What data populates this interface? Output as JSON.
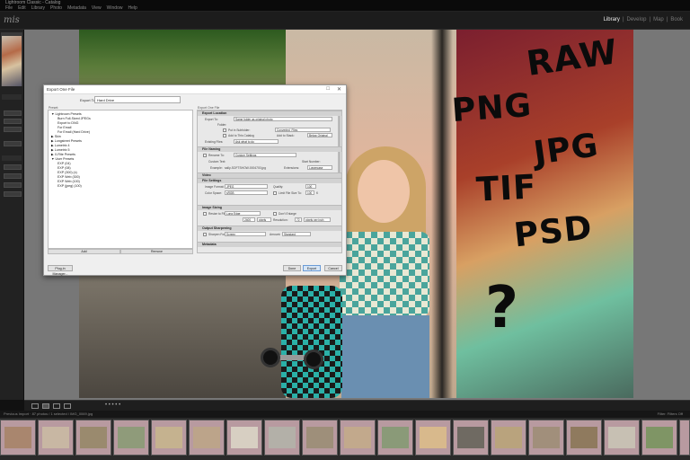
{
  "window": {
    "title": "Lightroom Classic - Catalog",
    "menu": [
      "File",
      "Edit",
      "Library",
      "Photo",
      "Metadata",
      "View",
      "Window",
      "Help"
    ]
  },
  "header": {
    "identity": "mis",
    "modules": [
      "Library",
      "Develop",
      "Map",
      "Book"
    ],
    "active_module": "Library"
  },
  "overlay_text": {
    "raw": "RAW",
    "png": "PNG",
    "jpg": "JPG",
    "tif": "TIF",
    "psd": "PSD",
    "question": "?"
  },
  "dialog": {
    "title": "Export One File",
    "export_to_label": "Export To:",
    "export_to_value": "Hard Drive",
    "preset_label": "Preset:",
    "settings_label": "Export One File",
    "presets": [
      "▼ Lightroom Presets",
      "Burn Full-Sized JPEGs",
      "Export to DNG",
      "For Email",
      "For Email (Hard Drive)",
      "▶ Skin",
      "▶ Longstreet Presets",
      "▶ Lumetrix 4",
      "▶ Lumetrix 5",
      "▶ X-Rite Presets",
      "▼ User Presets",
      "EXP (04)",
      "EXP (08)",
      "EXP (300) (x)",
      "EXP Web (300)",
      "EXP Web (100)",
      "EXP (jpeg) (100)"
    ],
    "preset_buttons": [
      "Add",
      "Remove"
    ],
    "sections": {
      "export_location": "Export Location",
      "file_naming": "File Naming",
      "video": "Video",
      "file_settings": "File Settings",
      "image_sizing": "Image Sizing",
      "output_sharpening": "Output Sharpening",
      "metadata": "Metadata"
    },
    "fields": {
      "export_to": "Export To:",
      "export_to_value": "Same folder as original photo",
      "folder": "Folder:",
      "put_in_subfolder": "Put in Subfolder:",
      "subfolder_value": "Converted_Files",
      "add_to_catalog": "Add to This Catalog",
      "add_to_stack": "Add to Stack:",
      "add_to_stack_value": "Below Original",
      "existing_files": "Existing Files:",
      "existing_files_value": "Ask what to do",
      "rename_to": "Rename To:",
      "rename_value": "Custom Settings",
      "custom_text": "Custom Text:",
      "start_number": "Start Number:",
      "example": "Example:",
      "example_value": "sally-SOFTSHOW-0004700.jpg",
      "extensions": "Extensions:",
      "extensions_value": "Lowercase",
      "image_format": "Image Format:",
      "image_format_value": "JPEG",
      "quality": "Quality:",
      "quality_value": "100",
      "color_space": "Color Space:",
      "color_space_value": "sRGB",
      "limit_file_size": "Limit File Size To:",
      "limit_value": "100",
      "limit_unit": "K",
      "resize_to_fit": "Resize to Fit:",
      "resize_value": "Long Edge",
      "dont_enlarge": "Don't Enlarge",
      "resize_size": "2400",
      "resize_unit": "pixels",
      "resolution": "Resolution:",
      "resolution_value": "72",
      "resolution_unit": "pixels per inch",
      "sharpen_for": "Sharpen For:",
      "sharpen_value": "Screen",
      "amount": "Amount:",
      "amount_value": "Standard"
    },
    "plugin_manager": "Plug-in Manager...",
    "done": "Done",
    "export": "Export",
    "cancel": "Cancel"
  },
  "filmstrip": {
    "path": "Previous Import · 87 photos / 1 selected / IMG_0069.jpg",
    "filter_label": "Filter:",
    "filter_value": "Filters Off",
    "count": 26
  },
  "colors": {
    "accent_selected": "#b8b8b8",
    "dialog_bg": "#efefef",
    "panel_bg": "#222222",
    "filmstrip_bg": "#2a2a2a"
  }
}
